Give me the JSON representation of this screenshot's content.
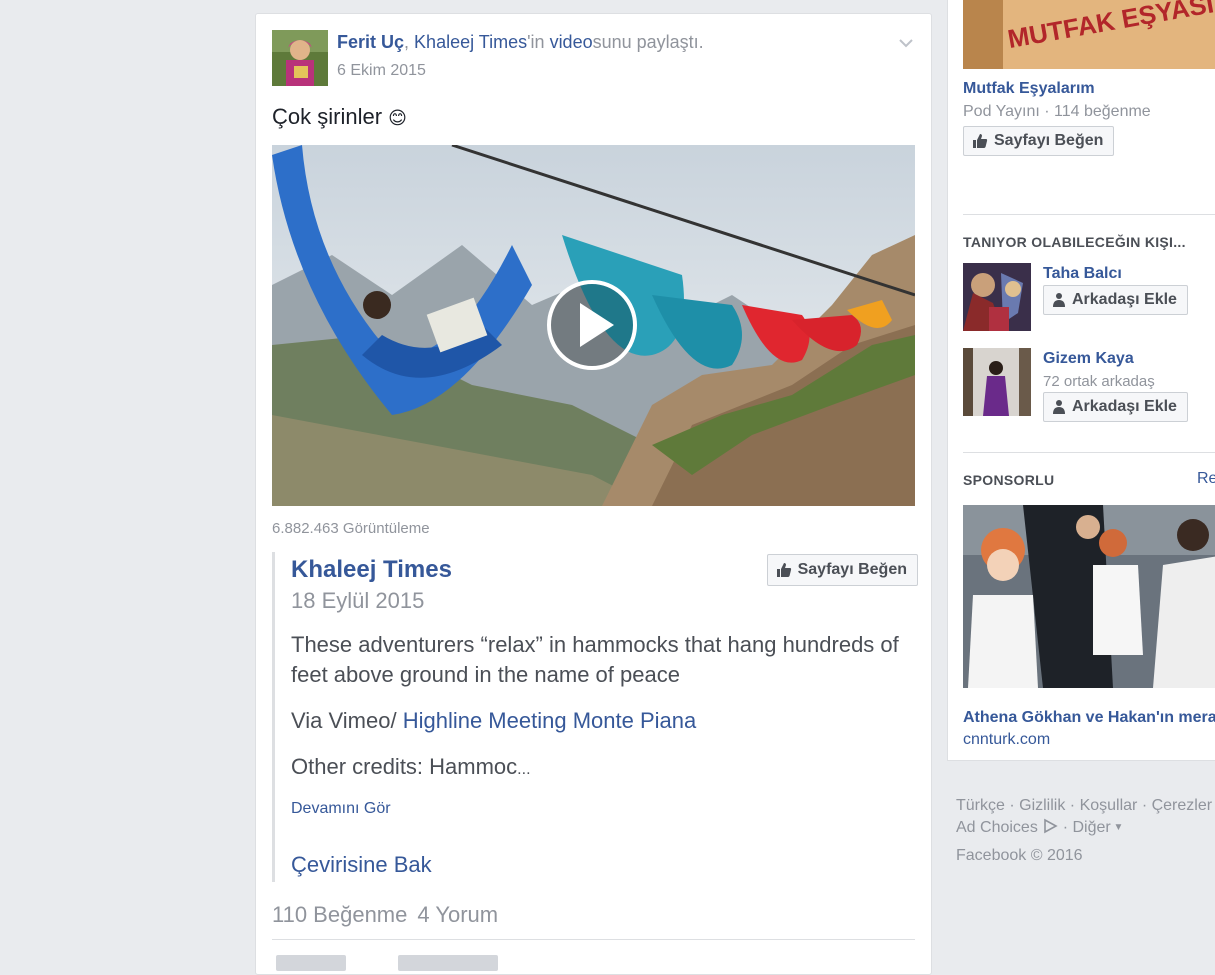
{
  "post": {
    "author": "Ferit Uç",
    "comma": ", ",
    "page": "Khaleej Times",
    "possessive": "'in ",
    "video_word": "video",
    "action_suffix": "sunu paylaştı.",
    "date": "6 Ekim 2015",
    "text": "Çok şirinler",
    "emoji": "😊",
    "views": "6.882.463 Görüntüleme",
    "likes": "110 Beğenme",
    "comments": "4 Yorum"
  },
  "shared": {
    "page_name": "Khaleej Times",
    "date": "18 Eylül 2015",
    "like_button": "Sayfayı Beğen",
    "paragraph1": "These adventurers “relax” in hammocks that hang hundreds of feet above ground in the name of peace",
    "via_prefix": "Via Vimeo/ ",
    "via_link": "Highline Meeting Monte Piana",
    "paragraph3": "Other credits: Hammoc",
    "ellipsis": "...",
    "see_more": "Devamını Gör",
    "translate": "Çevirisine Bak"
  },
  "sidebar": {
    "ad_image_text": "MUTFAK EŞYASI",
    "page_name": "Mutfak Eşyalarım",
    "page_meta": "Pod Yayını · 114 beğenme",
    "page_like_button": "Sayfayı Beğen",
    "pymk_title": "TANIYOR OLABILECEĞIN KIŞI...",
    "people": [
      {
        "name": "Taha Balcı",
        "meta": "",
        "button": "Arkadaşı Ekle"
      },
      {
        "name": "Gizem Kaya",
        "meta": "72 ortak arkadaş",
        "button": "Arkadaşı Ekle"
      }
    ],
    "sponsored_title": "SPONSORLU",
    "sponsored_link": "Re",
    "ad_title": "Athena Gökhan ve Hakan'ın mera",
    "ad_domain": "cnnturk.com"
  },
  "footer": {
    "links": [
      "Türkçe",
      "Gizlilik",
      "Koşullar",
      "Çerezler"
    ],
    "ad_choices": "Ad Choices",
    "more": "Diğer",
    "copyright": "Facebook © 2016"
  },
  "colors": {
    "link": "#365899",
    "muted": "#90949c",
    "background": "#e9ebee"
  }
}
